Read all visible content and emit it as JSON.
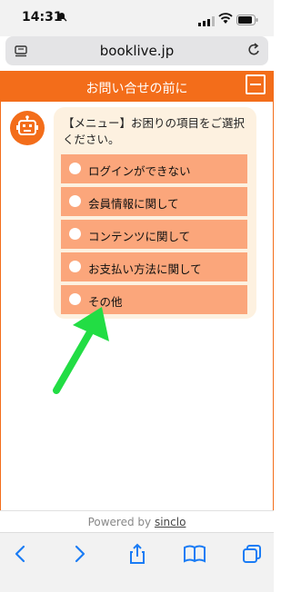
{
  "status": {
    "time": "14:31"
  },
  "browser": {
    "url": "booklive.jp"
  },
  "chat": {
    "title": "お問い合せの前に",
    "message": "【メニュー】お困りの項目をご選択ください。",
    "options": [
      {
        "label": "ログインができない"
      },
      {
        "label": "会員情報に関して"
      },
      {
        "label": "コンテンツに関して"
      },
      {
        "label": "お支払い方法に関して"
      },
      {
        "label": "その他"
      }
    ],
    "footer_prefix": "Powered by ",
    "footer_brand": "sinclo"
  },
  "colors": {
    "accent": "#f36d1a",
    "option_bg": "#fba67b",
    "bubble_bg": "#fdf1e0",
    "arrow": "#22dd44",
    "ios_blue": "#1a7cf5"
  }
}
